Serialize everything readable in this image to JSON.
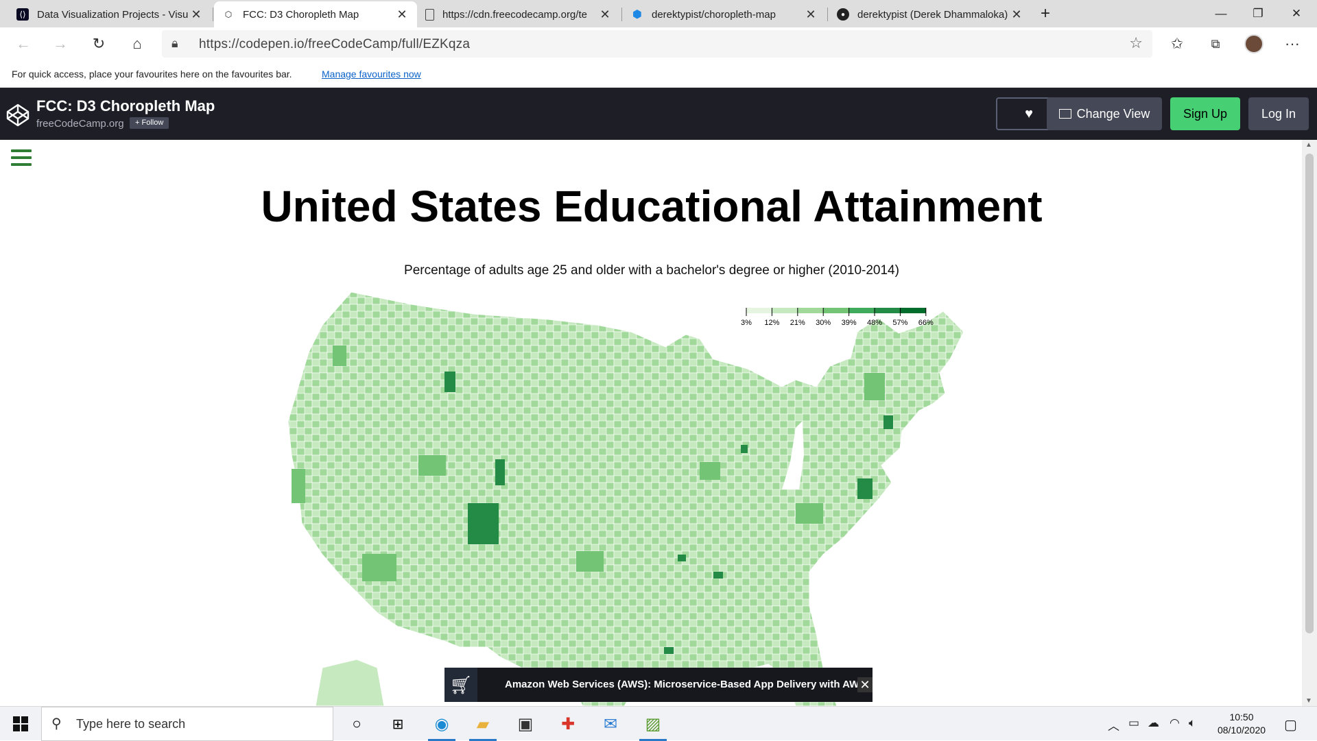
{
  "browser": {
    "tabs": [
      {
        "title": "Data Visualization Projects - Visu",
        "icon": "fcc-icon",
        "active": false
      },
      {
        "title": "FCC: D3 Choropleth Map",
        "icon": "codepen-icon",
        "active": true
      },
      {
        "title": "https://cdn.freecodecamp.org/te",
        "icon": "file-icon",
        "active": false
      },
      {
        "title": "derektypist/choropleth-map",
        "icon": "cube-icon",
        "active": false
      },
      {
        "title": "derektypist (Derek Dhammaloka)",
        "icon": "github-icon",
        "active": false
      }
    ],
    "url": "https://codepen.io/freeCodeCamp/full/EZKqza",
    "favbar_text": "For quick access, place your favourites here on the favourites bar.",
    "favbar_link": "Manage favourites now"
  },
  "codepen": {
    "title": "FCC: D3 Choropleth Map",
    "user": "freeCodeCamp.org",
    "follow": "+ Follow",
    "change_view": "Change View",
    "sign_up": "Sign Up",
    "log_in": "Log In",
    "colors": {
      "header": "#1e1f26",
      "signup": "#47cf73",
      "button": "#444857"
    }
  },
  "page": {
    "title": "United States Educational Attainment",
    "description": "Percentage of adults age 25 and older with a bachelor's degree or higher (2010-2014)"
  },
  "chart_data": {
    "type": "choropleth",
    "legend": {
      "ticks": [
        "3%",
        "12%",
        "21%",
        "30%",
        "39%",
        "48%",
        "57%",
        "66%"
      ],
      "colors": [
        "#e5f5e0",
        "#c7e9c0",
        "#a1d99b",
        "#74c476",
        "#41ab5d",
        "#238b45",
        "#006d2c"
      ]
    }
  },
  "ad": {
    "text": "Amazon Web Services (AWS): Microservice-Based App Delivery with AWS",
    "close": "✕"
  },
  "taskbar": {
    "search_placeholder": "Type here to search",
    "time": "10:50",
    "date": "08/10/2020"
  }
}
